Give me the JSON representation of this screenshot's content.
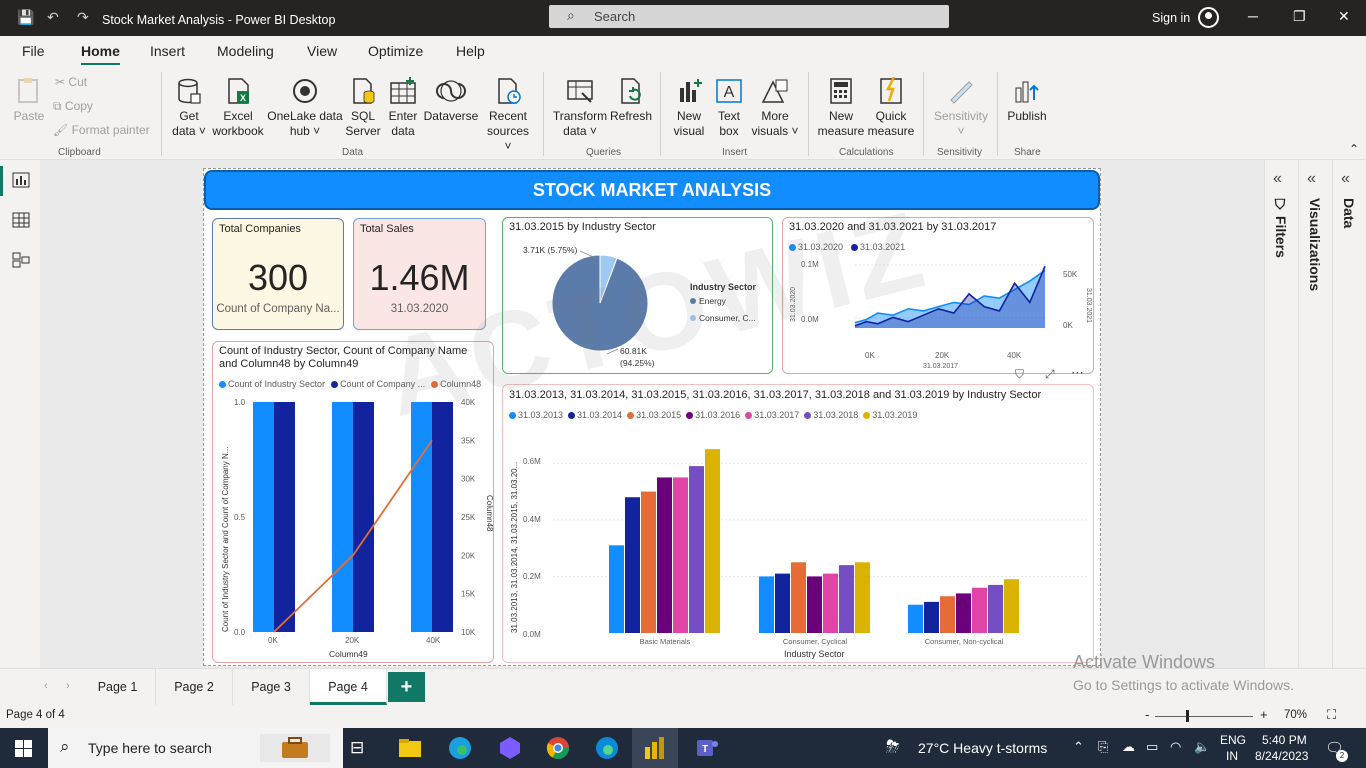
{
  "titlebar": {
    "title": "Stock Market Analysis - Power BI Desktop",
    "search_placeholder": "Search",
    "sign_in": "Sign in"
  },
  "menu_tabs": [
    "File",
    "Home",
    "Insert",
    "Modeling",
    "View",
    "Optimize",
    "Help"
  ],
  "ribbon": {
    "clipboard": {
      "paste": "Paste",
      "cut": "Cut",
      "copy": "Copy",
      "format_painter": "Format painter",
      "label": "Clipboard"
    },
    "data": {
      "get_data": [
        "Get",
        "data"
      ],
      "excel": [
        "Excel",
        "workbook"
      ],
      "onelake": [
        "OneLake data",
        "hub"
      ],
      "sql": [
        "SQL",
        "Server"
      ],
      "enter": [
        "Enter",
        "data"
      ],
      "dataverse": [
        "Dataverse"
      ],
      "recent": [
        "Recent",
        "sources"
      ],
      "label": "Data"
    },
    "queries": {
      "transform": [
        "Transform",
        "data"
      ],
      "refresh": [
        "Refresh"
      ],
      "label": "Queries"
    },
    "insert": {
      "new_visual": [
        "New",
        "visual"
      ],
      "text_box": [
        "Text",
        "box"
      ],
      "more_visuals": [
        "More",
        "visuals"
      ],
      "label": "Insert"
    },
    "calculations": {
      "new_measure": [
        "New",
        "measure"
      ],
      "quick_measure": [
        "Quick",
        "measure"
      ],
      "label": "Calculations"
    },
    "sensitivity": {
      "button": [
        "Sensitivity"
      ],
      "label": "Sensitivity"
    },
    "share": {
      "publish": [
        "Publish"
      ],
      "label": "Share"
    }
  },
  "report": {
    "banner": "STOCK MARKET ANALYSIS",
    "watermark": "ACTOWIZ",
    "kpi_companies": {
      "title": "Total Companies",
      "value": "300",
      "sub": "Count of Company Na..."
    },
    "kpi_sales": {
      "title": "Total Sales",
      "value": "1.46M",
      "sub": "31.03.2020"
    },
    "pie": {
      "title": "31.03.2015 by Industry Sector",
      "legend_title": "Industry Sector",
      "legend": [
        "Energy",
        "Consumer, C..."
      ],
      "label_small": "3.71K (5.75%)",
      "label_large_1": "60.81K",
      "label_large_2": "(94.25%)"
    },
    "line_chart": {
      "title": "31.03.2020 and 31.03.2021 by 31.03.2017",
      "legend": [
        "31.03.2020",
        "31.03.2021"
      ],
      "y_left": [
        "0.1M",
        "0.0M"
      ],
      "y_right": [
        "50K",
        "0K"
      ],
      "x_ticks": [
        "0K",
        "20K",
        "40K"
      ],
      "x_label": "31.03.2017",
      "y_left_label": "31.03.2020",
      "y_right_label": "31.03.2021"
    },
    "combo": {
      "title_1": "Count of Industry Sector, Count of Company Name",
      "title_2": "and Column48 by Column49",
      "legend": [
        "Count of Industry Sector",
        "Count of Company ...",
        "Column48"
      ],
      "y_left_ticks": [
        "1.0",
        "0.5",
        "0.0"
      ],
      "y_right_ticks": [
        "40K",
        "35K",
        "30K",
        "25K",
        "20K",
        "15K",
        "10K"
      ],
      "x_ticks": [
        "0K",
        "20K",
        "40K"
      ],
      "x_label": "Column49",
      "y_left_label": "Count of Industry Sector and Count of Company N...",
      "y_right_label": "Column48"
    },
    "clustered": {
      "title": "31.03.2013, 31.03.2014, 31.03.2015, 31.03.2016, 31.03.2017, 31.03.2018 and 31.03.2019 by Industry Sector",
      "legend": [
        "31.03.2013",
        "31.03.2014",
        "31.03.2015",
        "31.03.2016",
        "31.03.2017",
        "31.03.2018",
        "31.03.2019"
      ],
      "y_ticks": [
        "0.6M",
        "0.4M",
        "0.2M",
        "0.0M"
      ],
      "x_label": "Industry Sector",
      "y_label": "31.03.2013, 31.03.2014, 31.03.2015, 31.03.20..."
    }
  },
  "panes": {
    "filters": "Filters",
    "visualizations": "Visualizations",
    "data": "Data"
  },
  "pages": [
    "Page 1",
    "Page 2",
    "Page 3",
    "Page 4"
  ],
  "activate": {
    "line1": "Activate Windows",
    "line2": "Go to Settings to activate Windows."
  },
  "status": {
    "page_info": "Page 4 of 4",
    "zoom": "70%"
  },
  "taskbar": {
    "search": "Type here to search",
    "weather": "27°C  Heavy t-storms",
    "lang_1": "ENG",
    "lang_2": "IN",
    "time": "5:40 PM",
    "date": "8/24/2023",
    "notif_count": "2"
  },
  "chart_data": [
    {
      "type": "pie",
      "title": "31.03.2015 by Industry Sector",
      "categories": [
        "Energy",
        "Consumer, C..."
      ],
      "values": [
        60810,
        3710
      ],
      "percent": [
        94.25,
        5.75
      ],
      "colors": [
        "#5b7bab",
        "#9ec9f3"
      ]
    },
    {
      "type": "area",
      "title": "31.03.2020 and 31.03.2021 by 31.03.2017",
      "series": [
        {
          "name": "31.03.2020",
          "x": [
            0,
            3,
            6,
            10,
            14,
            18,
            22,
            26,
            30,
            34,
            38,
            42,
            46,
            50
          ],
          "values": [
            5,
            8,
            14,
            12,
            18,
            16,
            20,
            24,
            22,
            30,
            28,
            36,
            44,
            54
          ]
        },
        {
          "name": "31.03.2021",
          "x": [
            0,
            3,
            6,
            10,
            14,
            18,
            22,
            26,
            30,
            34,
            38,
            42,
            46,
            50
          ],
          "values": [
            2,
            6,
            4,
            10,
            6,
            12,
            18,
            14,
            32,
            20,
            16,
            42,
            24,
            58
          ]
        }
      ],
      "colors": [
        "#118dff",
        "#12239e"
      ],
      "xlim": [
        0,
        50
      ],
      "ylim": [
        0,
        60
      ]
    },
    {
      "type": "bar",
      "title": "Count of Industry Sector, Count of Company Name and Column48 by Column49",
      "categories": [
        "0K",
        "20K",
        "40K"
      ],
      "series": [
        {
          "name": "Count of Industry Sector",
          "values": [
            1,
            1,
            1
          ]
        },
        {
          "name": "Count of Company ...",
          "values": [
            1,
            1,
            1
          ]
        },
        {
          "name": "Column48",
          "values": [
            10000,
            20000,
            35000
          ]
        }
      ],
      "colors": [
        "#118dff",
        "#12239e",
        "#e66c37"
      ],
      "ylim": [
        0,
        1
      ],
      "y2lim": [
        10000,
        40000
      ]
    },
    {
      "type": "bar",
      "title": "31.03.2013, 31.03.2014, 31.03.2015, 31.03.2016, 31.03.2017, 31.03.2018 and 31.03.2019 by Industry Sector",
      "categories": [
        "Basic Materials",
        "Consumer, Cyclical",
        "Consumer, Non-cyclical"
      ],
      "series": [
        {
          "name": "31.03.2013",
          "values": [
            0.31,
            0.2,
            0.1
          ]
        },
        {
          "name": "31.03.2014",
          "values": [
            0.48,
            0.21,
            0.11
          ]
        },
        {
          "name": "31.03.2015",
          "values": [
            0.5,
            0.25,
            0.13
          ]
        },
        {
          "name": "31.03.2016",
          "values": [
            0.55,
            0.2,
            0.14
          ]
        },
        {
          "name": "31.03.2017",
          "values": [
            0.55,
            0.21,
            0.16
          ]
        },
        {
          "name": "31.03.2018",
          "values": [
            0.59,
            0.24,
            0.17
          ]
        },
        {
          "name": "31.03.2019",
          "values": [
            0.65,
            0.25,
            0.19
          ]
        }
      ],
      "colors": [
        "#118dff",
        "#12239e",
        "#e66c37",
        "#6b007b",
        "#e044a7",
        "#744ec2",
        "#d9b300"
      ],
      "ylim": [
        0,
        0.7
      ]
    }
  ]
}
